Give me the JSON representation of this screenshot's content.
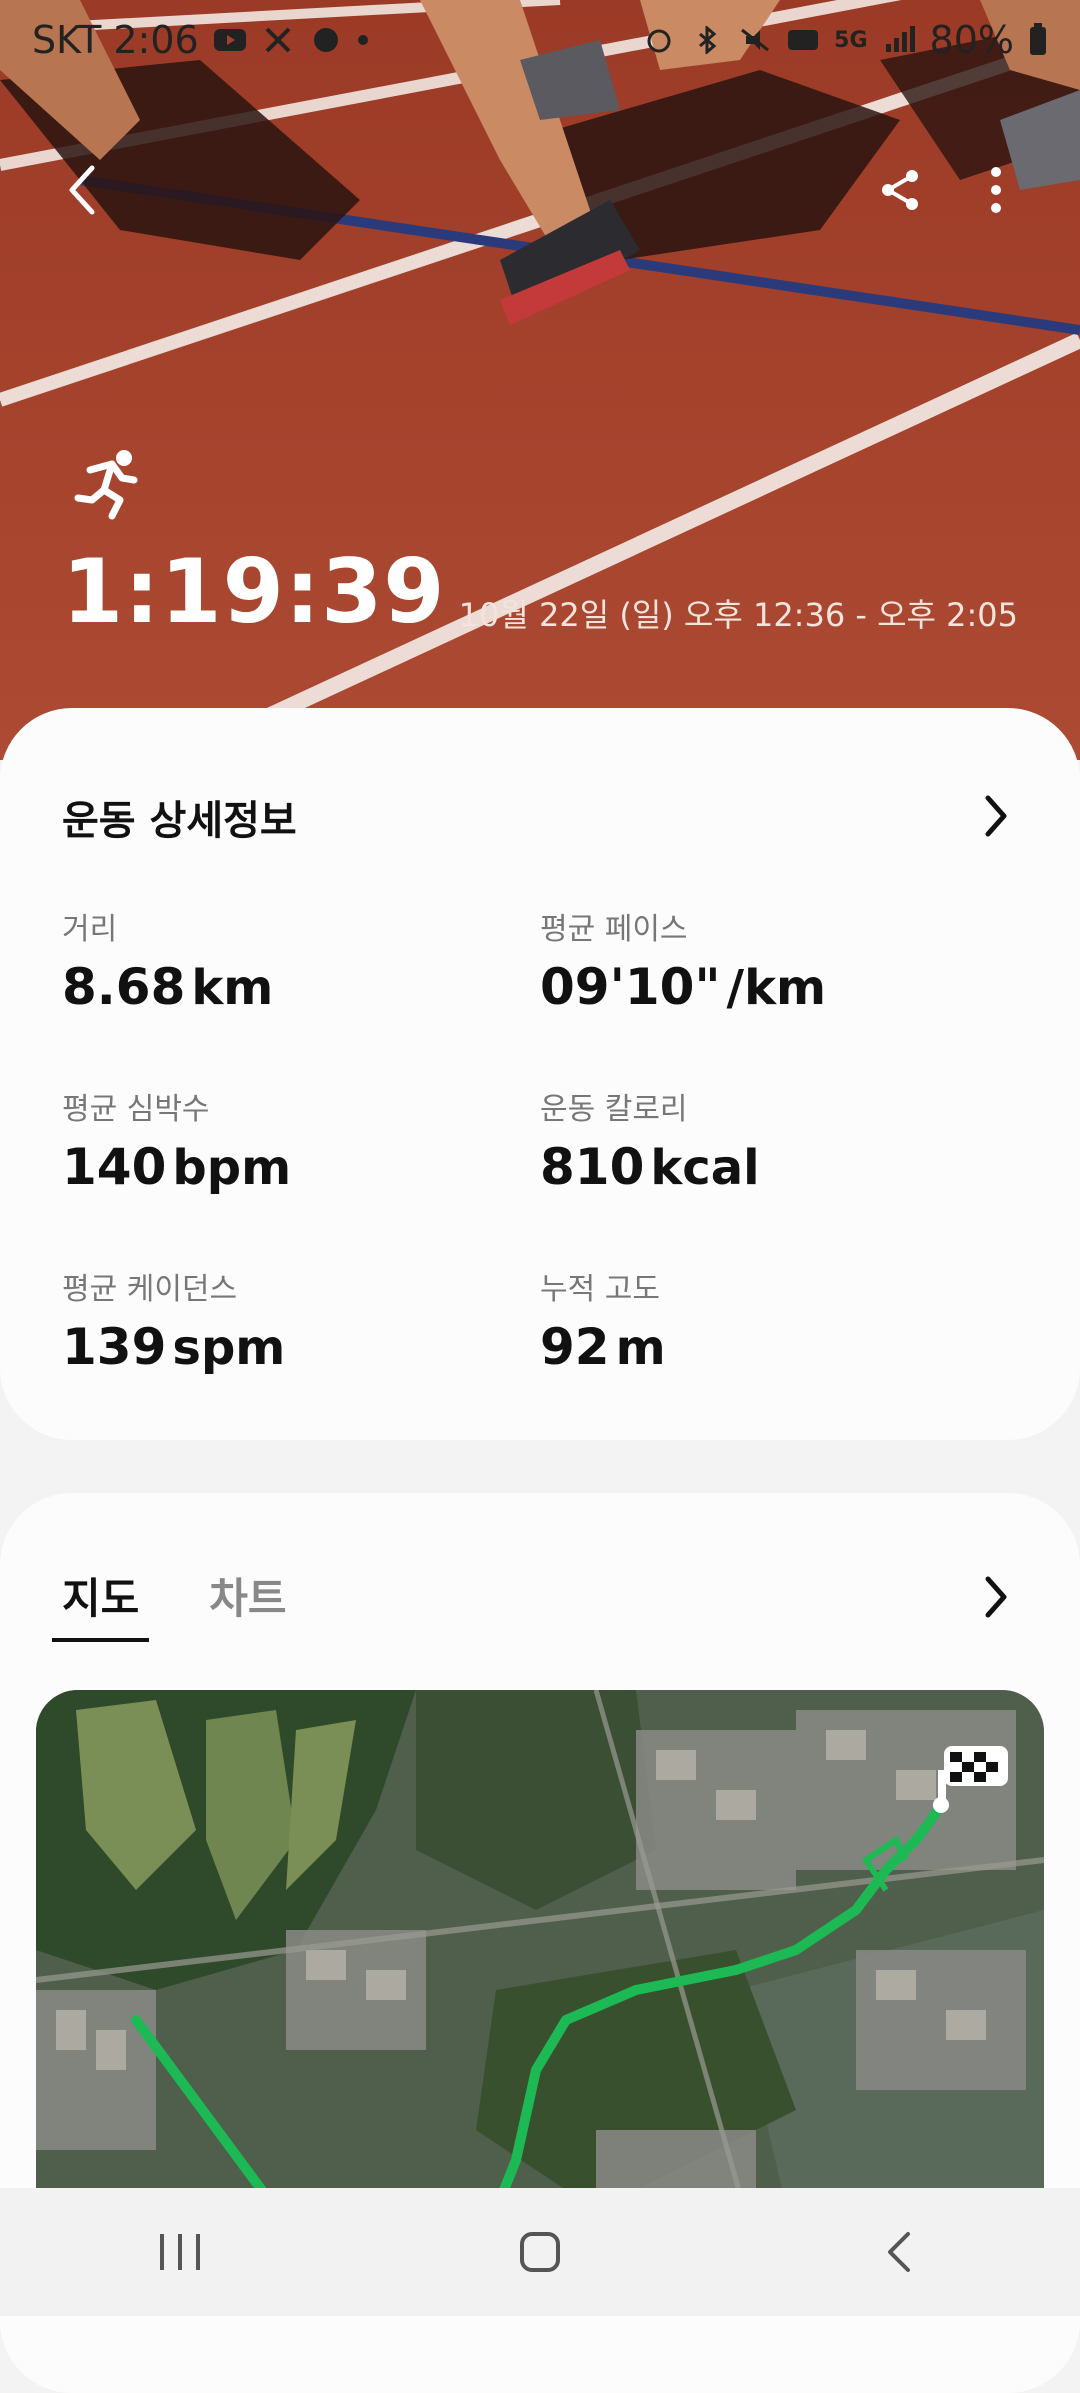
{
  "status_bar": {
    "carrier_time": "SKT 2:06",
    "battery": "80%",
    "network": "5G"
  },
  "hero": {
    "duration": "1:19:39",
    "date_range": "10월 22일 (일) 오후 12:36 - 오후 2:05",
    "icons": [
      "back-icon",
      "share-icon",
      "more-icon",
      "running-icon"
    ]
  },
  "details": {
    "title": "운동 상세정보",
    "stats": [
      {
        "label": "거리",
        "value": "8.68",
        "unit": "km"
      },
      {
        "label": "평균 페이스",
        "value": "09'10\"",
        "unit": "/km"
      },
      {
        "label": "평균 심박수",
        "value": "140",
        "unit": "bpm"
      },
      {
        "label": "운동 칼로리",
        "value": "810",
        "unit": "kcal"
      },
      {
        "label": "평균 케이던스",
        "value": "139",
        "unit": "spm"
      },
      {
        "label": "누적 고도",
        "value": "92",
        "unit": "m"
      }
    ]
  },
  "map_section": {
    "tabs": [
      "지도",
      "차트"
    ],
    "active_tab": "지도",
    "route_color": "#1db954"
  },
  "colors": {
    "track": "#a5412b",
    "card": "#fcfcfc",
    "background": "#f3f3f3"
  }
}
